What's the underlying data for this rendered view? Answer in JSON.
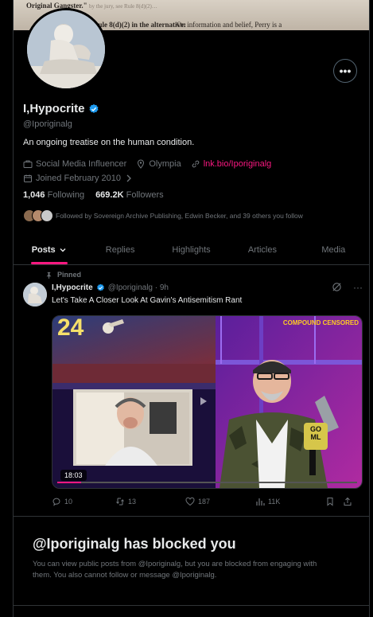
{
  "banner": {
    "line1": "Original Gangster.\"",
    "line1_faint": "by the jury, see Rule 8(d)(2)…",
    "line2_bold": "Rule 8(d)(2) in the alternative:",
    "line2_rest": " On information and belief, Perry is a"
  },
  "profile": {
    "more_label": "•••",
    "display_name": "I,Hypocrite",
    "handle": "@Iporiginalg",
    "bio": "An ongoing treatise on the human condition.",
    "category": "Social Media Influencer",
    "location": "Olympia",
    "link": "lnk.bio/Iporiginalg",
    "joined": "Joined February 2010",
    "following_count": "1,046",
    "following_label": "Following",
    "followers_count": "669.2K",
    "followers_label": "Followers",
    "followed_by": "Followed by Sovereign Archive Publishing, Edwin Becker, and 39 others you follow"
  },
  "tabs": [
    {
      "label": "Posts"
    },
    {
      "label": "Replies"
    },
    {
      "label": "Highlights"
    },
    {
      "label": "Articles"
    },
    {
      "label": "Media"
    }
  ],
  "tweet": {
    "pinned_label": "Pinned",
    "author": "I,Hypocrite",
    "handle_time": "@Iporiginalg · 9h",
    "more": "···",
    "text": "Let's Take A Closer Look At Gavin's Antisemitism Rant",
    "media": {
      "corner_number": "24",
      "brand": "COMPOUND CENSORED",
      "mic_label_top": "GO",
      "mic_label_bottom": "ML",
      "duration": "18:03"
    },
    "replies": "10",
    "reposts": "13",
    "likes": "187",
    "views": "11K"
  },
  "blocked": {
    "title": "@Iporiginalg has blocked you",
    "text": "You can view public posts from @Iporiginalg, but you are blocked from engaging with them. You also cannot follow or message @Iporiginalg."
  },
  "colors": {
    "accent": "#f91880",
    "verified": "#1d9bf0",
    "muted": "#71767b",
    "background": "#000000"
  }
}
